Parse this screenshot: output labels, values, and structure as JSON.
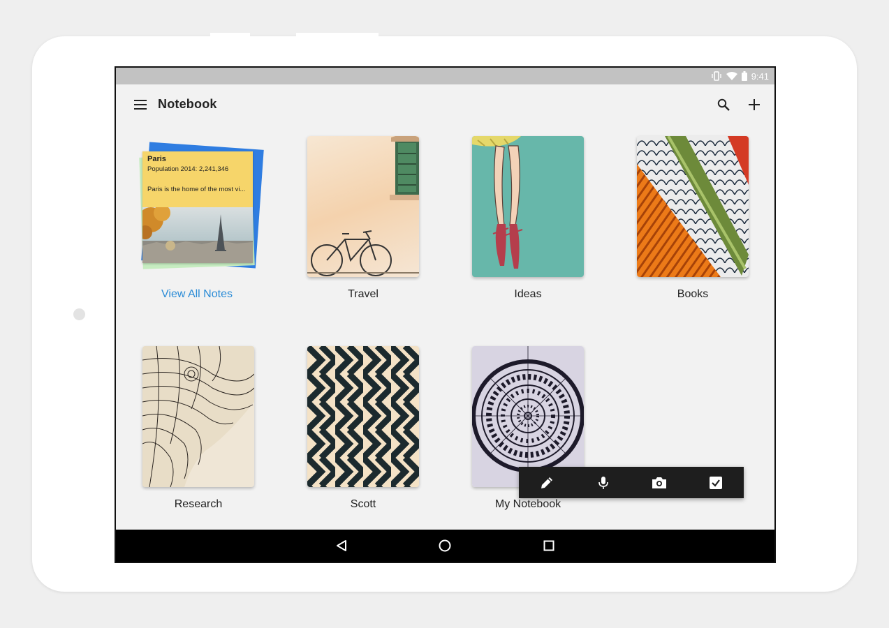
{
  "status_bar": {
    "time": "9:41"
  },
  "app_bar": {
    "title": "Notebook"
  },
  "all_notes": {
    "note_title": "Paris",
    "note_line1": "Population 2014: 2,241,346",
    "note_line2": "Paris is the home of the most vi...",
    "label": "View All Notes"
  },
  "notebooks": [
    {
      "label": "Travel"
    },
    {
      "label": "Ideas"
    },
    {
      "label": "Books"
    },
    {
      "label": "Research"
    },
    {
      "label": "Scott"
    },
    {
      "label": "My Notebook"
    }
  ],
  "colors": {
    "accent_link": "#2a8bd6",
    "sticky_yellow": "#f6d56a",
    "stack_blue": "#2f7de1",
    "quick_bar": "#1e1e1e"
  },
  "icons": {
    "menu": "menu-icon",
    "search": "search-icon",
    "add": "plus-icon",
    "pencil": "pencil-icon",
    "mic": "microphone-icon",
    "camera": "camera-icon",
    "checkbox": "checkbox-icon",
    "back": "back-triangle-icon",
    "home": "home-circle-icon",
    "recents": "recents-square-icon"
  }
}
